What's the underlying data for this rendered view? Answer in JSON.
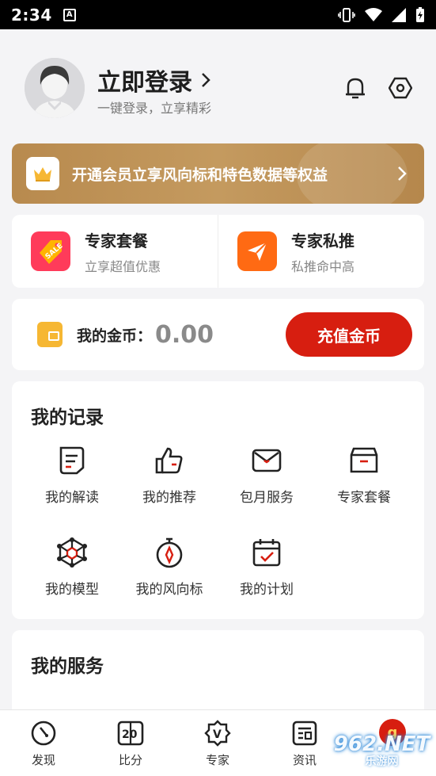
{
  "status_bar": {
    "time": "2:34",
    "notif_icon": "A"
  },
  "profile": {
    "title": "立即登录",
    "subtitle": "一键登录，立享精彩"
  },
  "vip_banner": {
    "text": "开通会员立享风向标和特色数据等权益"
  },
  "packages": [
    {
      "title": "专家套餐",
      "subtitle": "立享超值优惠",
      "icon": "sale-tag-icon",
      "badge": "SALE"
    },
    {
      "title": "专家私推",
      "subtitle": "私推命中高",
      "icon": "paper-plane-icon"
    }
  ],
  "coins": {
    "label": "我的金币：",
    "value": "0.00",
    "button": "充值金币"
  },
  "records": {
    "title": "我的记录",
    "items": [
      {
        "label": "我的解读",
        "icon": "document-icon"
      },
      {
        "label": "我的推荐",
        "icon": "thumbs-up-icon"
      },
      {
        "label": "包月服务",
        "icon": "envelope-icon"
      },
      {
        "label": "专家套餐",
        "icon": "box-icon"
      },
      {
        "label": "我的模型",
        "icon": "model-icon"
      },
      {
        "label": "我的风向标",
        "icon": "compass-icon"
      },
      {
        "label": "我的计划",
        "icon": "calendar-check-icon"
      }
    ]
  },
  "services": {
    "title": "我的服务"
  },
  "tabbar": {
    "tabs": [
      {
        "label": "发现",
        "icon": "discover-icon"
      },
      {
        "label": "比分",
        "icon": "score-icon",
        "glyph": "20"
      },
      {
        "label": "专家",
        "icon": "expert-badge-icon",
        "glyph": "V"
      },
      {
        "label": "资讯",
        "icon": "news-icon"
      }
    ],
    "badge": "g"
  },
  "watermark": {
    "main": "962.NET",
    "sub": "乐游网"
  },
  "colors": {
    "accent": "#d71e10",
    "gold": "#c49a5f",
    "wallet": "#f6b733",
    "plane": "#ff6a13"
  }
}
